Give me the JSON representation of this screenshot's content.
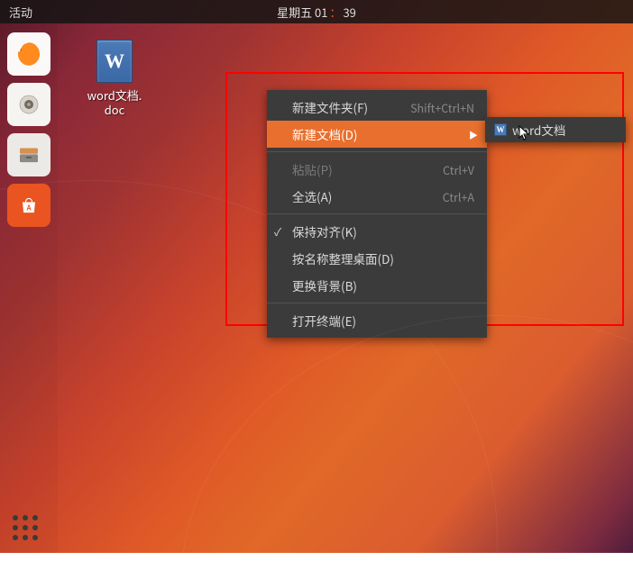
{
  "topbar": {
    "activities": "活动",
    "date": "星期五 01",
    "time": "39"
  },
  "desktop_icon": {
    "glyph": "W",
    "label_line1": "word文档.",
    "label_line2": "doc"
  },
  "dock": [
    {
      "name": "firefox"
    },
    {
      "name": "media-player"
    },
    {
      "name": "file-manager"
    },
    {
      "name": "software-center"
    }
  ],
  "context_menu": {
    "items": [
      {
        "label": "新建文件夹(F)",
        "shortcut": "Shift+Ctrl+N",
        "type": "item"
      },
      {
        "label": "新建文档(D)",
        "type": "submenu",
        "selected": true
      },
      {
        "type": "separator"
      },
      {
        "label": "粘贴(P)",
        "shortcut": "Ctrl+V",
        "type": "item",
        "disabled": true
      },
      {
        "label": "全选(A)",
        "shortcut": "Ctrl+A",
        "type": "item"
      },
      {
        "type": "separator"
      },
      {
        "label": "保持对齐(K)",
        "type": "check",
        "checked": true
      },
      {
        "label": "按名称整理桌面(D)",
        "type": "item"
      },
      {
        "label": "更换背景(B)",
        "type": "item"
      },
      {
        "type": "separator"
      },
      {
        "label": "打开终端(E)",
        "type": "item"
      }
    ]
  },
  "submenu": {
    "items": [
      {
        "label": "word文档",
        "icon": "W"
      }
    ]
  }
}
